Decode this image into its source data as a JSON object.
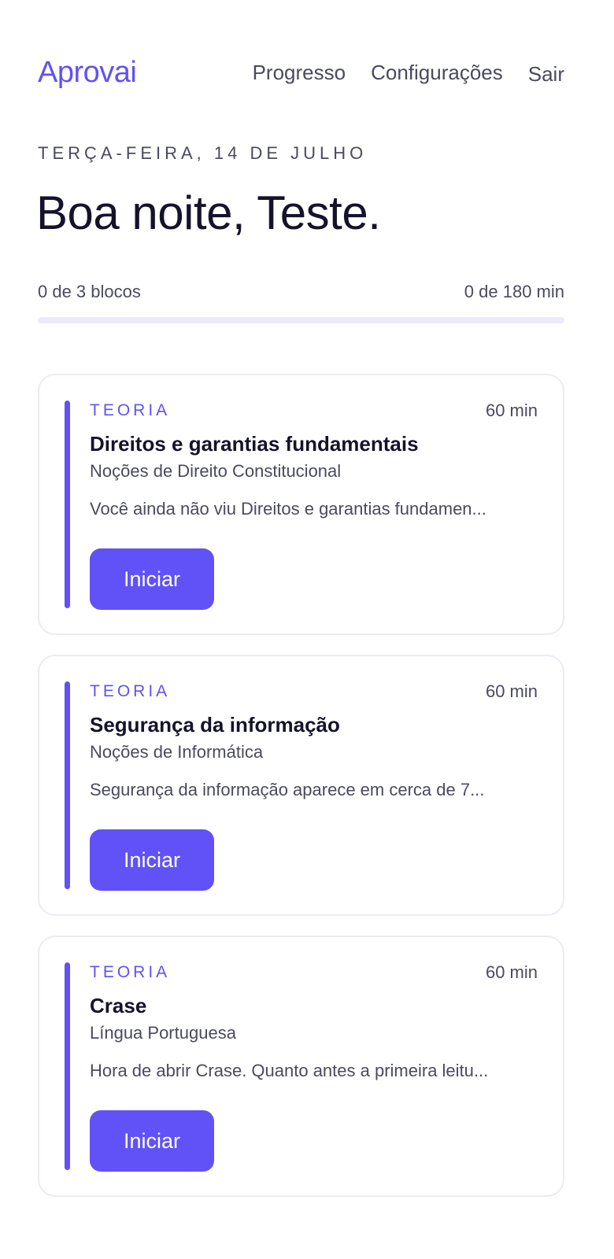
{
  "header": {
    "brand": "Aprovai",
    "nav": [
      "Progresso",
      "Configurações",
      "Sair"
    ]
  },
  "date_label": "TERÇA-FEIRA, 14 DE JULHO",
  "greeting": "Boa noite, Teste.",
  "progress": {
    "blocks_text": "0 de 3 blocos",
    "minutes_text": "0 de 180 min",
    "fraction": 0
  },
  "colors": {
    "accent": "#6052f6",
    "text_primary": "#15132b",
    "text_secondary": "#4a4a5e",
    "track": "#eceafa"
  },
  "blocks": [
    {
      "kind": "TEORIA",
      "duration": "60 min",
      "title": "Direitos e garantias fundamentais",
      "subject": "Noções de Direito Constitucional",
      "description": "Você ainda não viu Direitos e garantias fundamen...",
      "button": "Iniciar"
    },
    {
      "kind": "TEORIA",
      "duration": "60 min",
      "title": "Segurança da informação",
      "subject": "Noções de Informática",
      "description": "Segurança da informação aparece em cerca de 7...",
      "button": "Iniciar"
    },
    {
      "kind": "TEORIA",
      "duration": "60 min",
      "title": "Crase",
      "subject": "Língua Portuguesa",
      "description": "Hora de abrir Crase. Quanto antes a primeira leitu...",
      "button": "Iniciar"
    }
  ]
}
